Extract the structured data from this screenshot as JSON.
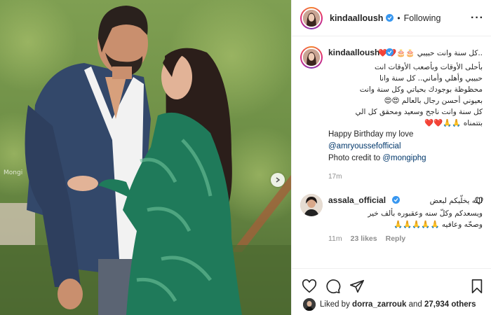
{
  "photo": {
    "alt_watermark": "Mongi"
  },
  "post": {
    "author": "kindaalloush",
    "follow_status": "Following",
    "more_icon": "more-horizontal-icon",
    "caption": {
      "line1": "..كل سنة وانت حبيبي 🎂🎂❤️❤️",
      "line2": "بأحلى الأوقات وبأصعب الأوقات انت",
      "line3": "حبيبي وأهلي وأماني.. كل سنة وانا",
      "line4": "محظوظة بوجودك بحياتي وكل سنة وانت",
      "line5": "بعيوني أحسن رجال بالعالم 😍😍",
      "line6": "كل سنة وانت ناجح وسعيد ومحقق كل الي",
      "line7": "بتتمناه 🙏🙏❤️❤️",
      "english": "Happy Birthday my love",
      "mention1": "@amryoussefofficial",
      "photo_credit_prefix": "Photo credit to ",
      "mention2": "@mongiphg",
      "time": "17m"
    },
    "comment": {
      "author": "assala_official",
      "line1": "الله يخلّيكم لبعض",
      "line2": "ويسعدكم وكلّ سنه وعقبوره بألف خير",
      "line3": "وصحّه وعافيه 🙏🙏🙏🙏🙏",
      "time": "11m",
      "likes": "23 likes",
      "reply": "Reply"
    },
    "likes": {
      "prefix": "Liked by ",
      "user": "dorra_zarrouk",
      "middle": " and ",
      "count": "27,934 others"
    }
  },
  "colors": {
    "verified": "#3897f0",
    "mention": "#00376b",
    "muted": "#8e8e8e"
  }
}
